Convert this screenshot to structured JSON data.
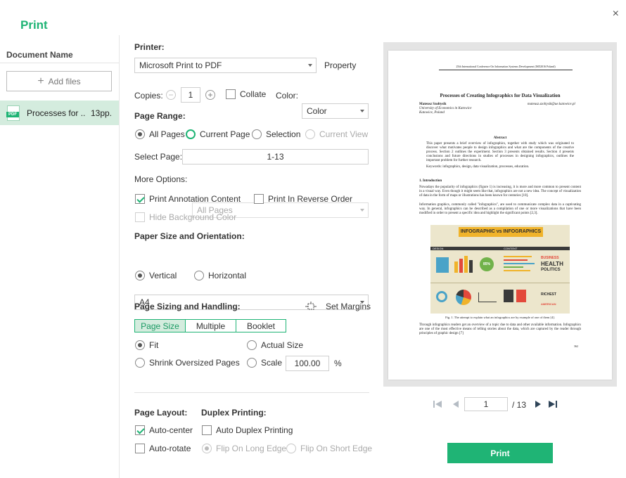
{
  "dialog": {
    "title": "Print",
    "close_label": "×"
  },
  "sidebar": {
    "header": "Document Name",
    "add_files": "Add files",
    "documents": [
      {
        "name": "Processes for ..",
        "pages": "13pp.",
        "icon": "PDF"
      }
    ]
  },
  "printer": {
    "label": "Printer:",
    "selected": "Microsoft Print to PDF",
    "property": "Property"
  },
  "copies": {
    "label": "Copies:",
    "value": "1",
    "collate": "Collate",
    "color_label": "Color:",
    "color_selected": "Color"
  },
  "page_range": {
    "label": "Page Range:",
    "options": [
      "All Pages",
      "Current Page",
      "Selection",
      "Current View"
    ],
    "select_page_label": "Select Page:",
    "select_page_value": "1-13",
    "more_options_label": "More Options:",
    "more_options_selected": "All Pages",
    "print_annotation": "Print Annotation Content",
    "reverse_order": "Print In Reverse Order",
    "hide_background": "Hide Background Color"
  },
  "paper": {
    "label": "Paper Size and Orientation:",
    "size": "A4",
    "orientation": [
      "Vertical",
      "Horizontal"
    ]
  },
  "sizing": {
    "label": "Page Sizing and Handling:",
    "set_margins": "Set Margins",
    "tabs": [
      "Page Size",
      "Multiple",
      "Booklet"
    ],
    "fit": "Fit",
    "actual_size": "Actual Size",
    "shrink": "Shrink Oversized Pages",
    "scale": "Scale",
    "scale_value": "100.00",
    "percent": "%"
  },
  "layout": {
    "page_layout_label": "Page Layout:",
    "duplex_label": "Duplex Printing:",
    "auto_center": "Auto-center",
    "auto_rotate": "Auto-rotate",
    "auto_duplex": "Auto Duplex Printing",
    "flip_long": "Flip On Long Edge",
    "flip_short": "Flip On Short Edge"
  },
  "preview": {
    "current_page": "1",
    "total_label": "/ 13",
    "page": {
      "header": "25th International Conference On Information Systems Development (ISD2016 Poland)",
      "title": "Processes of Creating Infographics for Data Visualization",
      "author": "Mateusz Szołtysik",
      "email": "mateusz.szoltysik@ue.katowice.pl",
      "affiliation": "University of Economics in Katowice",
      "city": "Katowice, Poland",
      "abstract_h": "Abstract",
      "abstract": "This paper presents a brief overview of infographics, together with study which was originated to discover what motivates people to design infographics and what are the components of the creative process. Section 2 outlines the experiment. Section 3 presents obtained results. Section 4 presents conclusions and future directions in studies of processes in designing infographics, outlines the important problem for further research.",
      "keywords": "Keywords: infographics, design, data visualization, processes, education.",
      "intro_h": "1.   Introduction",
      "intro1": "Nowadays the popularity of infographics (figure 1) is increasing, it is more and more common to present content in a visual way. Even though it might seem like that, infographics are not a new idea. The concept of visualization of data in the form of maps or illustrations has been known for centuries [10].",
      "intro2": "Information graphics, commonly called \"infographics\", are used to communicate complex data in a captivating way. In general, infographics can be described as a compilation of one or more visualizations that have been modified in order to present a specific idea and highlight the significant points [2,3].",
      "figure_title": "INFOGRAPHIC vs INFOGRAPHICS",
      "figure_design": "DESIGN",
      "figure_content": "CONTENT",
      "figure_pct": "85%",
      "figure_business": "BUSINESS",
      "figure_health": "HEALTH",
      "figure_politics": "POLITICS",
      "figure_richest": "RICHEST",
      "figure_america": "AMERICAN",
      "caption": "Fig. 1. The attempt to explain what an infographics are by example of one of them [4].",
      "para3": "Through infographics readers get an overview of a topic due to data and other available information. Infographics are one of the most effective means of telling stories about the data, which are captured by the reader through principles of graphic design [7]",
      "page_no": "362"
    }
  },
  "actions": {
    "print": "Print"
  },
  "colors": {
    "accent": "#1fb475",
    "selected_bg": "#d4ecde",
    "poster_bg": "#ece6cc",
    "poster_banner": "#f0b32a"
  }
}
